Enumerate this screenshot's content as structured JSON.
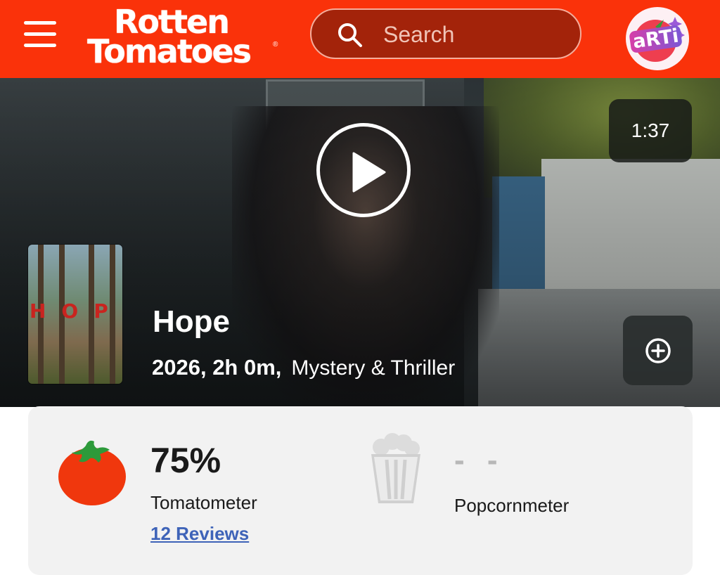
{
  "header": {
    "logo_line1": "Rotten",
    "logo_line2": "Tomatoes",
    "logo_reg": "®",
    "search_placeholder": "Search",
    "avatar_text": "aRTi",
    "menu_icon": "hamburger-menu-icon"
  },
  "hero": {
    "duration": "1:37",
    "title": "Hope",
    "meta": "2026, 2h 0m,",
    "genre": "Mystery & Thriller",
    "poster_title": "HOPE",
    "play_icon": "play-icon",
    "add_icon": "add-circle-icon"
  },
  "scores": {
    "tomatometer_value": "75%",
    "tomatometer_label": "Tomatometer",
    "reviews_link": "12 Reviews",
    "popcornmeter_value": "- -",
    "popcornmeter_label": "Popcornmeter"
  },
  "colors": {
    "brand": "#fa320a",
    "search_bg": "#a3230a",
    "link": "#3e63b8",
    "card_bg": "#f2f2f2"
  }
}
